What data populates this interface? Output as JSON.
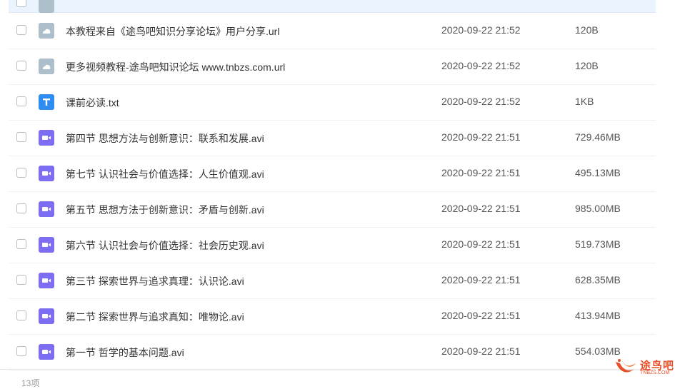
{
  "files": [
    {
      "name": "本教程来自《途鸟吧知识分享论坛》用户分享.url",
      "date": "2020-09-22 21:52",
      "size": "120B",
      "icon": "url-file-icon"
    },
    {
      "name": "更多视频教程-途鸟吧知识论坛 www.tnbzs.com.url",
      "date": "2020-09-22 21:52",
      "size": "120B",
      "icon": "url-file-icon"
    },
    {
      "name": "课前必读.txt",
      "date": "2020-09-22 21:52",
      "size": "1KB",
      "icon": "txt-file-icon"
    },
    {
      "name": "第四节 思想方法与创新意识：联系和发展.avi",
      "date": "2020-09-22 21:51",
      "size": "729.46MB",
      "icon": "video-file-icon"
    },
    {
      "name": "第七节 认识社会与价值选择：人生价值观.avi",
      "date": "2020-09-22 21:51",
      "size": "495.13MB",
      "icon": "video-file-icon"
    },
    {
      "name": "第五节 思想方法于创新意识：矛盾与创新.avi",
      "date": "2020-09-22 21:51",
      "size": "985.00MB",
      "icon": "video-file-icon"
    },
    {
      "name": "第六节 认识社会与价值选择：社会历史观.avi",
      "date": "2020-09-22 21:51",
      "size": "519.73MB",
      "icon": "video-file-icon"
    },
    {
      "name": "第三节 探索世界与追求真理：认识论.avi",
      "date": "2020-09-22 21:51",
      "size": "628.35MB",
      "icon": "video-file-icon"
    },
    {
      "name": "第二节 探索世界与追求真知：唯物论.avi",
      "date": "2020-09-22 21:51",
      "size": "413.94MB",
      "icon": "video-file-icon"
    },
    {
      "name": "第一节 哲学的基本问题.avi",
      "date": "2020-09-22 21:51",
      "size": "554.03MB",
      "icon": "video-file-icon"
    }
  ],
  "footer": {
    "count": "13项"
  },
  "watermark": {
    "text": "途鸟吧",
    "sub": "TNBZS.COM"
  },
  "colors": {
    "url_icon": "#aebfcc",
    "txt_icon": "#2f8cf0",
    "video_icon": "#7c6df2",
    "selected_row": "#eaf4fe",
    "watermark": "#e8502a"
  }
}
